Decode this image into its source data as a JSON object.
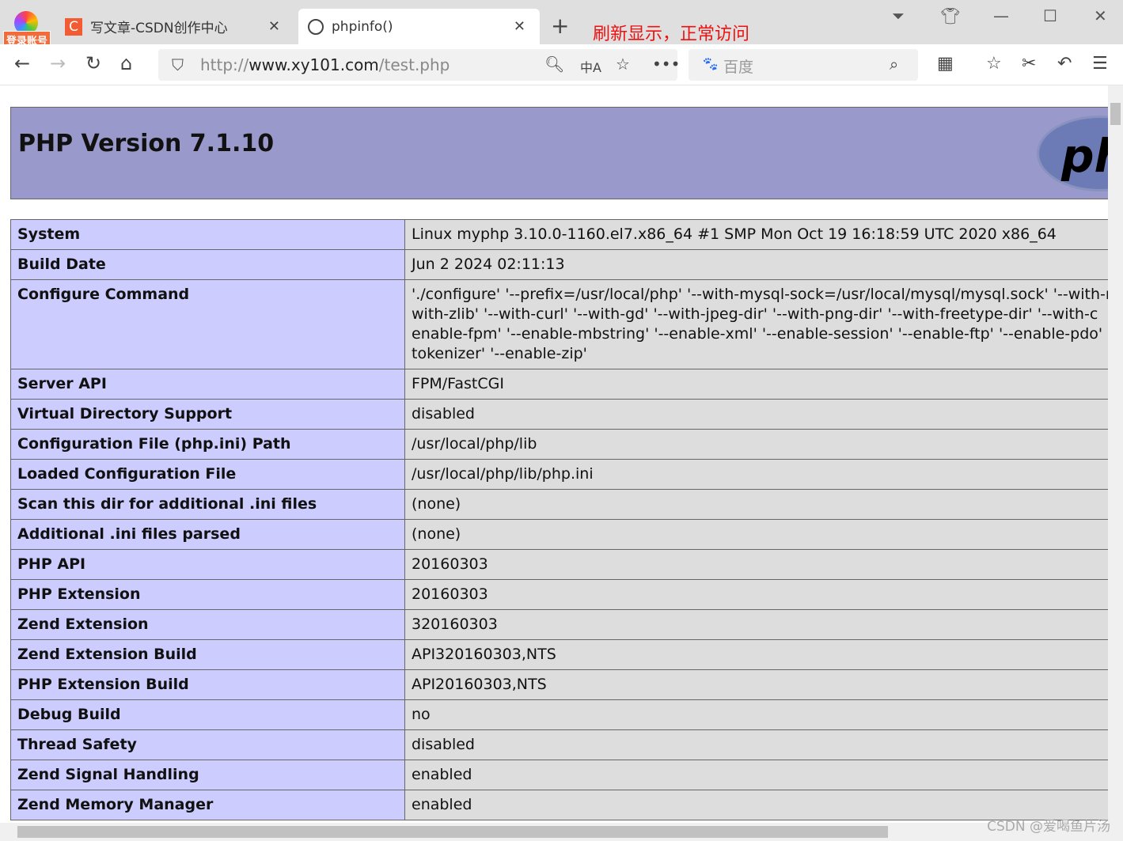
{
  "browser": {
    "login_label": "登录账号",
    "tabs": [
      {
        "title": "写文章-CSDN创作中心",
        "icon": "C"
      },
      {
        "title": "phpinfo()"
      }
    ],
    "annotation": "刷新显示，正常访问",
    "url_prefix": "http://",
    "url_host": "www.xy101.com",
    "url_path": "/test.php",
    "search_placeholder": "百度"
  },
  "page": {
    "title": "PHP Version 7.1.10",
    "logo_text": "php",
    "rows": [
      {
        "label": "System",
        "value": [
          "Linux myphp 3.10.0-1160.el7.x86_64 #1 SMP Mon Oct 19 16:18:59 UTC 2020 x86_64"
        ]
      },
      {
        "label": "Build Date",
        "value": [
          "Jun 2 2024 02:11:13"
        ]
      },
      {
        "label": "Configure Command",
        "value": [
          "'./configure' '--prefix=/usr/local/php' '--with-mysql-sock=/usr/local/mysql/mysql.sock' '--with-r",
          "with-zlib' '--with-curl' '--with-gd' '--with-jpeg-dir' '--with-png-dir' '--with-freetype-dir' '--with-c",
          "enable-fpm' '--enable-mbstring' '--enable-xml' '--enable-session' '--enable-ftp' '--enable-pdo' '",
          "tokenizer' '--enable-zip'"
        ]
      },
      {
        "label": "Server API",
        "value": [
          "FPM/FastCGI"
        ]
      },
      {
        "label": "Virtual Directory Support",
        "value": [
          "disabled"
        ]
      },
      {
        "label": "Configuration File (php.ini) Path",
        "value": [
          "/usr/local/php/lib"
        ]
      },
      {
        "label": "Loaded Configuration File",
        "value": [
          "/usr/local/php/lib/php.ini"
        ]
      },
      {
        "label": "Scan this dir for additional .ini files",
        "value": [
          "(none)"
        ]
      },
      {
        "label": "Additional .ini files parsed",
        "value": [
          "(none)"
        ]
      },
      {
        "label": "PHP API",
        "value": [
          "20160303"
        ]
      },
      {
        "label": "PHP Extension",
        "value": [
          "20160303"
        ]
      },
      {
        "label": "Zend Extension",
        "value": [
          "320160303"
        ]
      },
      {
        "label": "Zend Extension Build",
        "value": [
          "API320160303,NTS"
        ]
      },
      {
        "label": "PHP Extension Build",
        "value": [
          "API20160303,NTS"
        ]
      },
      {
        "label": "Debug Build",
        "value": [
          "no"
        ]
      },
      {
        "label": "Thread Safety",
        "value": [
          "disabled"
        ]
      },
      {
        "label": "Zend Signal Handling",
        "value": [
          "enabled"
        ]
      },
      {
        "label": "Zend Memory Manager",
        "value": [
          "enabled"
        ]
      }
    ]
  },
  "watermark": "CSDN @爱喝鱼片汤"
}
